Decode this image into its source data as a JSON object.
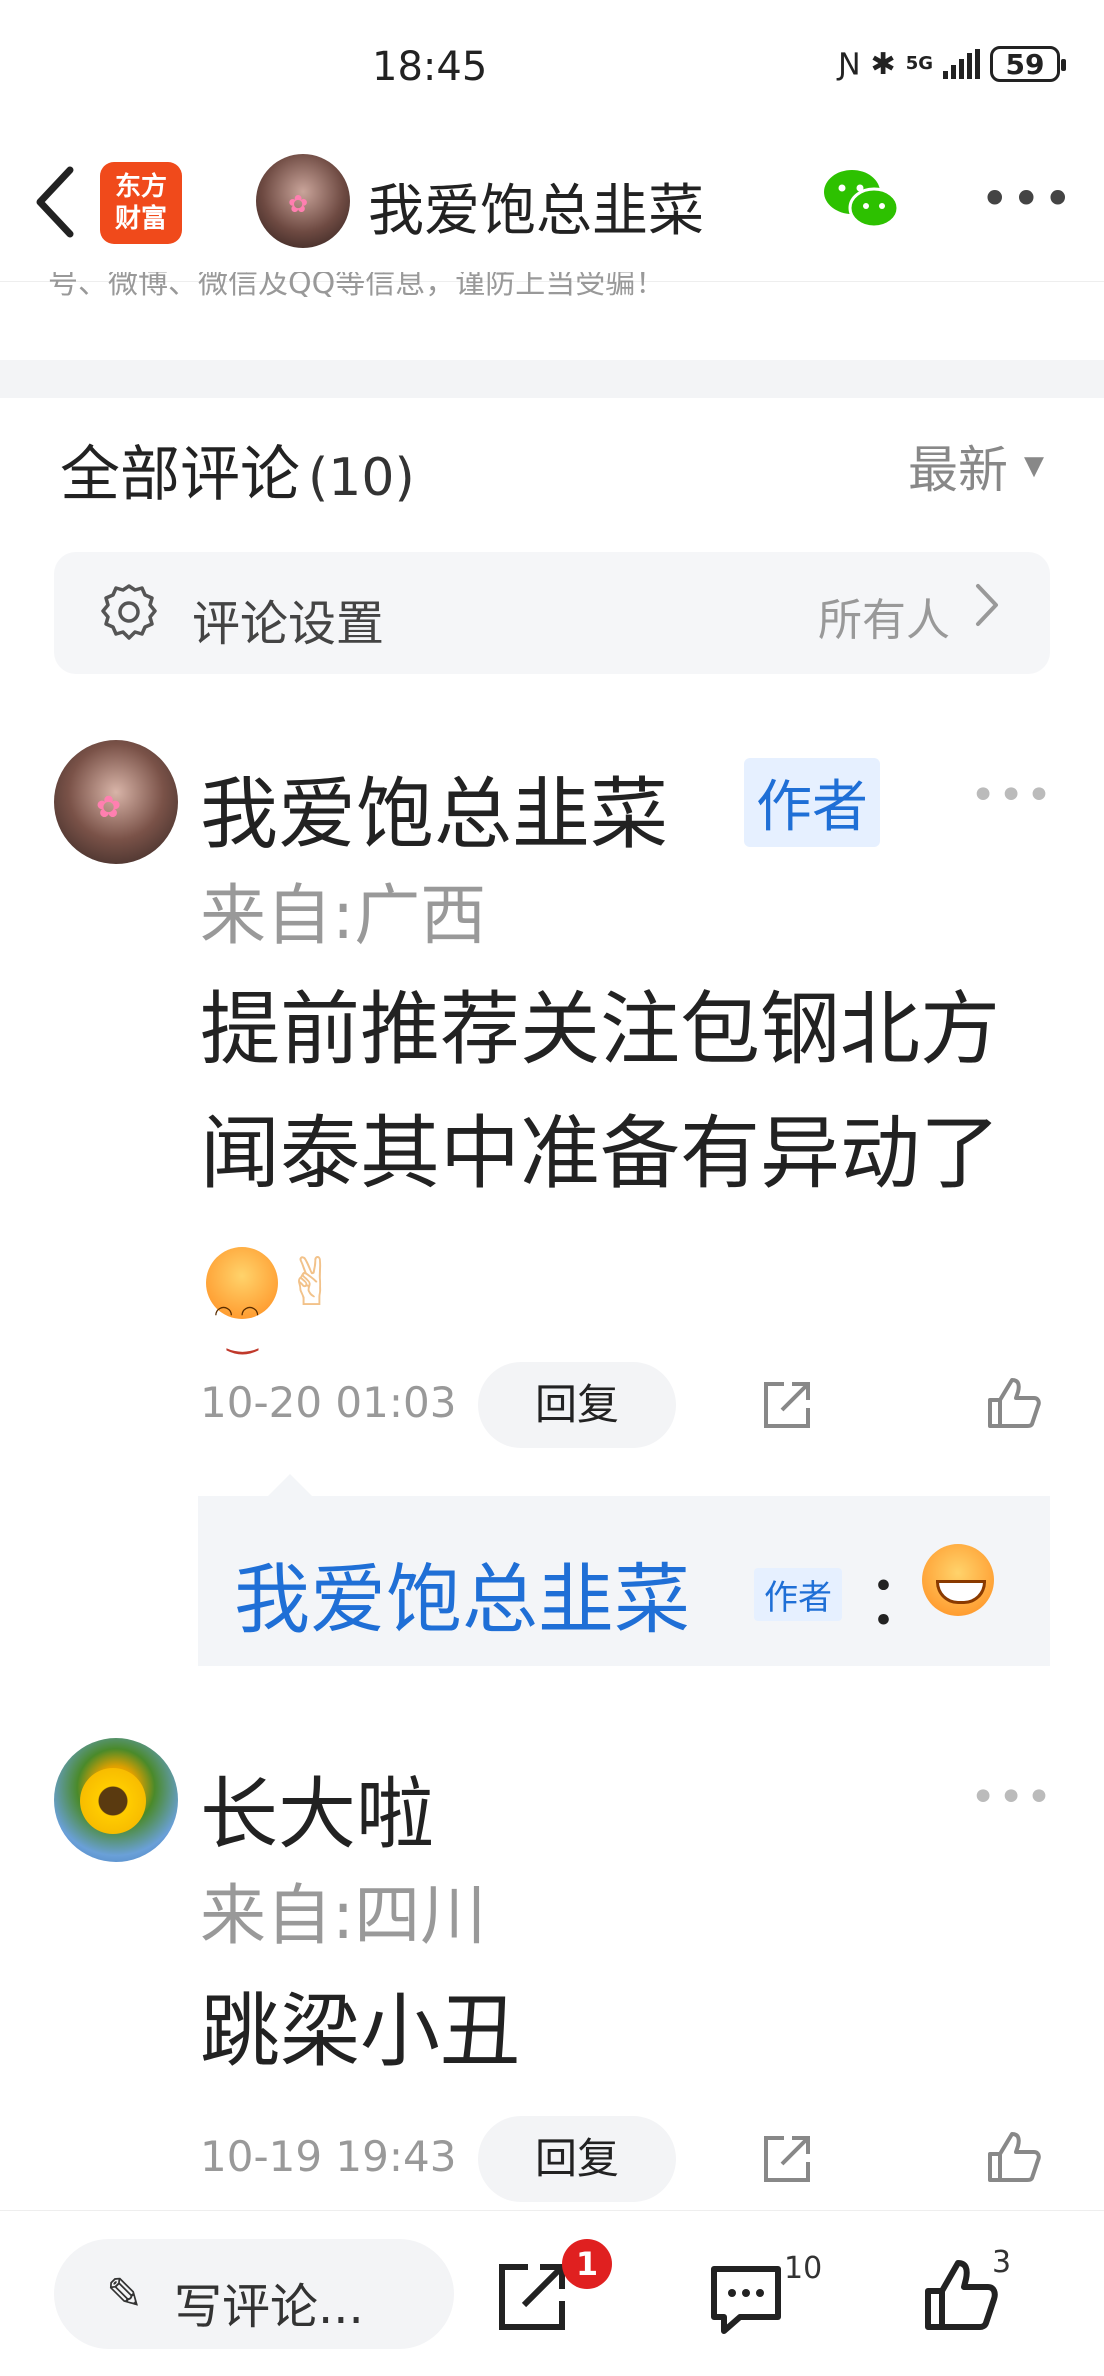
{
  "status": {
    "time": "18:45",
    "network": "5G",
    "battery": "59"
  },
  "nav": {
    "back_icon": "chevron-left-icon",
    "logo_line1": "东方",
    "logo_line2": "财富",
    "title": "我爱饱总韭菜",
    "wechat_icon": "wechat-icon",
    "more_icon": "more-icon"
  },
  "warning_text": "号、微博、微信及QQ等信息，谨防上当受骗！",
  "comments_header": {
    "title": "全部评论",
    "count": "(10)",
    "sort_label": "最新"
  },
  "settings": {
    "label": "评论设置",
    "value": "所有人"
  },
  "comments": [
    {
      "username": "我爱饱总韭菜",
      "tag": "作者",
      "location": "来自:广西",
      "text": "提前推荐关注包钢北方闻泰其中准备有异动了",
      "time": "10-20 01:03",
      "reply_label": "回复",
      "reply": {
        "username": "我爱饱总韭菜",
        "tag": "作者",
        "colon": "："
      }
    },
    {
      "username": "长大啦",
      "location": "来自:四川",
      "text": "跳梁小丑",
      "time": "10-19 19:43",
      "reply_label": "回复"
    }
  ],
  "bottom_bar": {
    "write_label": "写评论...",
    "share_badge": "1",
    "comment_count": "10",
    "like_count": "3"
  },
  "colors": {
    "brand": "#f04a1b",
    "author_blue": "#1f6fd6",
    "badge_red": "#e02020"
  }
}
